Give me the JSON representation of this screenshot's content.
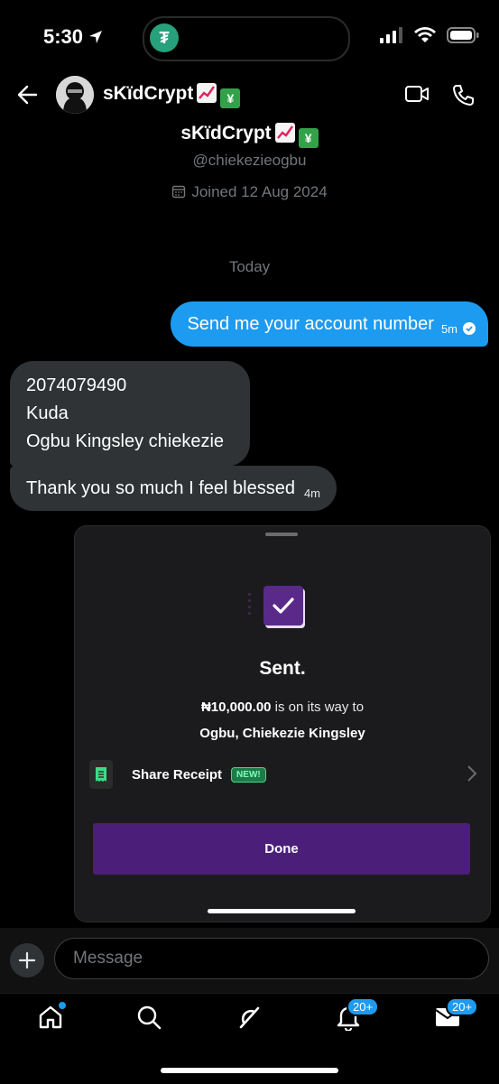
{
  "status_bar": {
    "time": "5:30",
    "app_badge": "₮"
  },
  "header": {
    "name": "sKïdCrypt"
  },
  "profile": {
    "name": "sKïdCrypt",
    "handle": "@chiekezieogbu",
    "joined": "Joined 12 Aug 2024"
  },
  "day_separator": "Today",
  "messages": [
    {
      "text": "Send me your account number",
      "time": "5m",
      "direction": "outgoing"
    },
    {
      "lines": [
        "2074079490",
        "Kuda",
        "Ogbu Kingsley chiekezie"
      ],
      "direction": "incoming"
    },
    {
      "text": "Thank you so much I feel blessed",
      "time": "4m",
      "direction": "incoming"
    }
  ],
  "sheet": {
    "title": "Sent.",
    "amount": "₦10,000.00",
    "amount_suffix": " is on its way to",
    "recipient": "Ogbu, Chiekezie Kingsley",
    "share_receipt": "Share Receipt",
    "new_badge": "NEW!",
    "done": "Done"
  },
  "composer": {
    "placeholder": "Message"
  },
  "tabbar": {
    "notifications_badge": "20+",
    "messages_badge": "20+"
  },
  "colors": {
    "accent": "#1d9bf0",
    "purple": "#4b1e7a",
    "bubble_in": "#2f3336"
  }
}
